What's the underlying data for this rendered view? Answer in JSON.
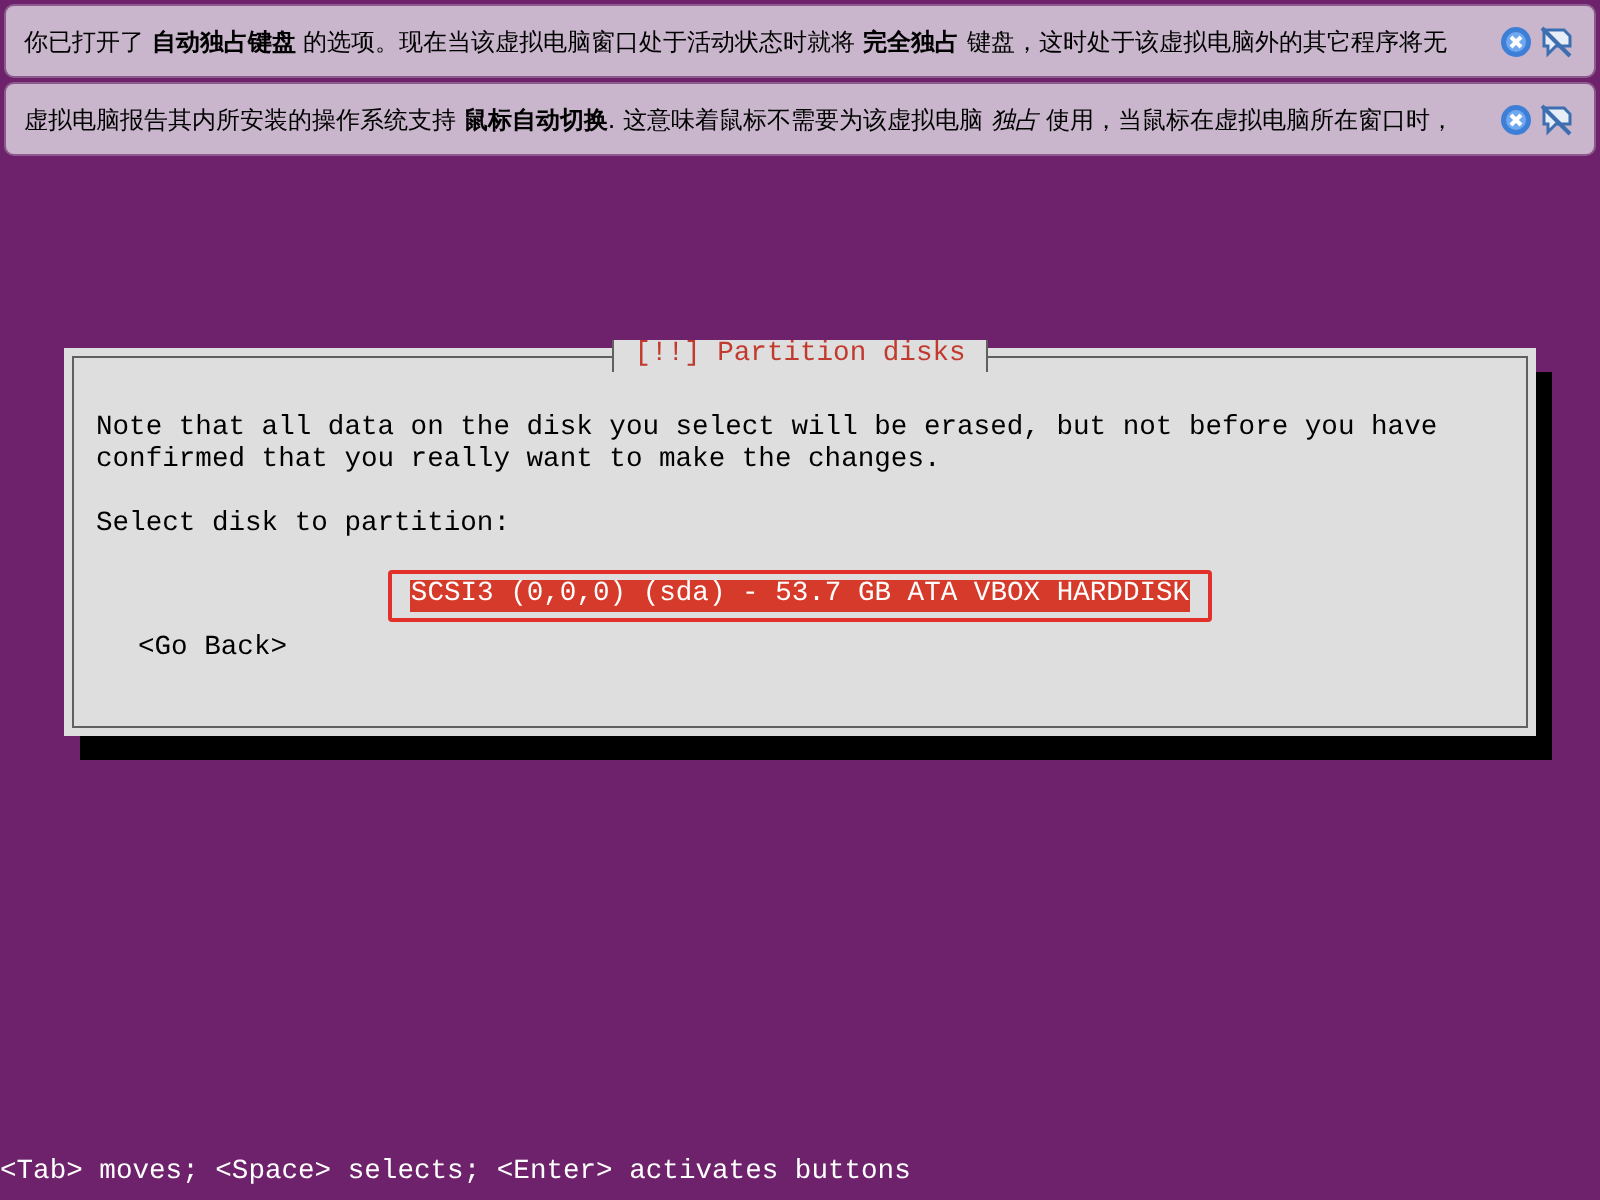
{
  "notifications": [
    {
      "text": "你已打开了 **自动独占键盘** 的选项。现在当该虚拟电脑窗口处于活动状态时就将 **完全独占** 键盘，这时处于该虚拟电脑外的其它程序将无"
    },
    {
      "text": "虚拟电脑报告其内所安装的操作系统支持 **鼠标自动切换**. 这意味着鼠标不需要为该虚拟电脑 *独占* 使用，当鼠标在虚拟电脑所在窗口时，"
    }
  ],
  "dialog": {
    "title": "[!!] Partition disks",
    "message": "Note that all data on the disk you select will be erased, but not before you have confirmed that you really want to make the changes.",
    "prompt": "Select disk to partition:",
    "options": [
      {
        "label": "SCSI3 (0,0,0) (sda) - 53.7 GB ATA VBOX HARDDISK",
        "selected": true
      }
    ],
    "back_button": "<Go Back>"
  },
  "status_bar": "<Tab> moves; <Space> selects; <Enter> activates buttons"
}
